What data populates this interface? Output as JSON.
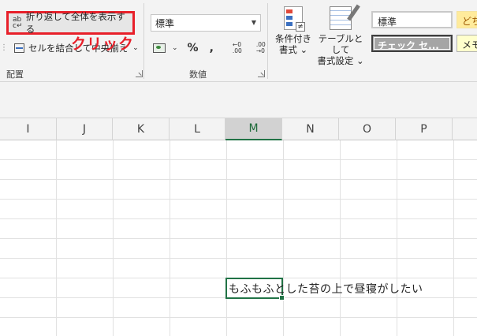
{
  "ribbon": {
    "alignment": {
      "wrap_text_label": "折り返して全体を表示する",
      "merge_center_label": "セルを結合して中央揃え",
      "group_label": "配置"
    },
    "annotation": {
      "text": "クリック",
      "color": "#e8202a"
    },
    "number": {
      "format_value": "標準",
      "percent_label": "%",
      "comma_label": ",",
      "increase_decimal_top": "←0",
      "increase_decimal_bottom": ".00",
      "decrease_decimal_top": ".00",
      "decrease_decimal_bottom": "→0",
      "group_label": "数値"
    },
    "styles": {
      "conditional_format_line1": "条件付き",
      "conditional_format_line2": "書式",
      "format_as_table_line1": "テーブルとして",
      "format_as_table_line2": "書式設定",
      "cell_styles": [
        "標準",
        "チェック セ...",
        "どち",
        "メモ"
      ]
    }
  },
  "sheet": {
    "columns": [
      "I",
      "J",
      "K",
      "L",
      "M",
      "N",
      "O",
      "P"
    ],
    "selected_column": "M",
    "active_cell_text": "もふもふとした苔の上で昼寝がしたい",
    "accent_color": "#217346"
  }
}
